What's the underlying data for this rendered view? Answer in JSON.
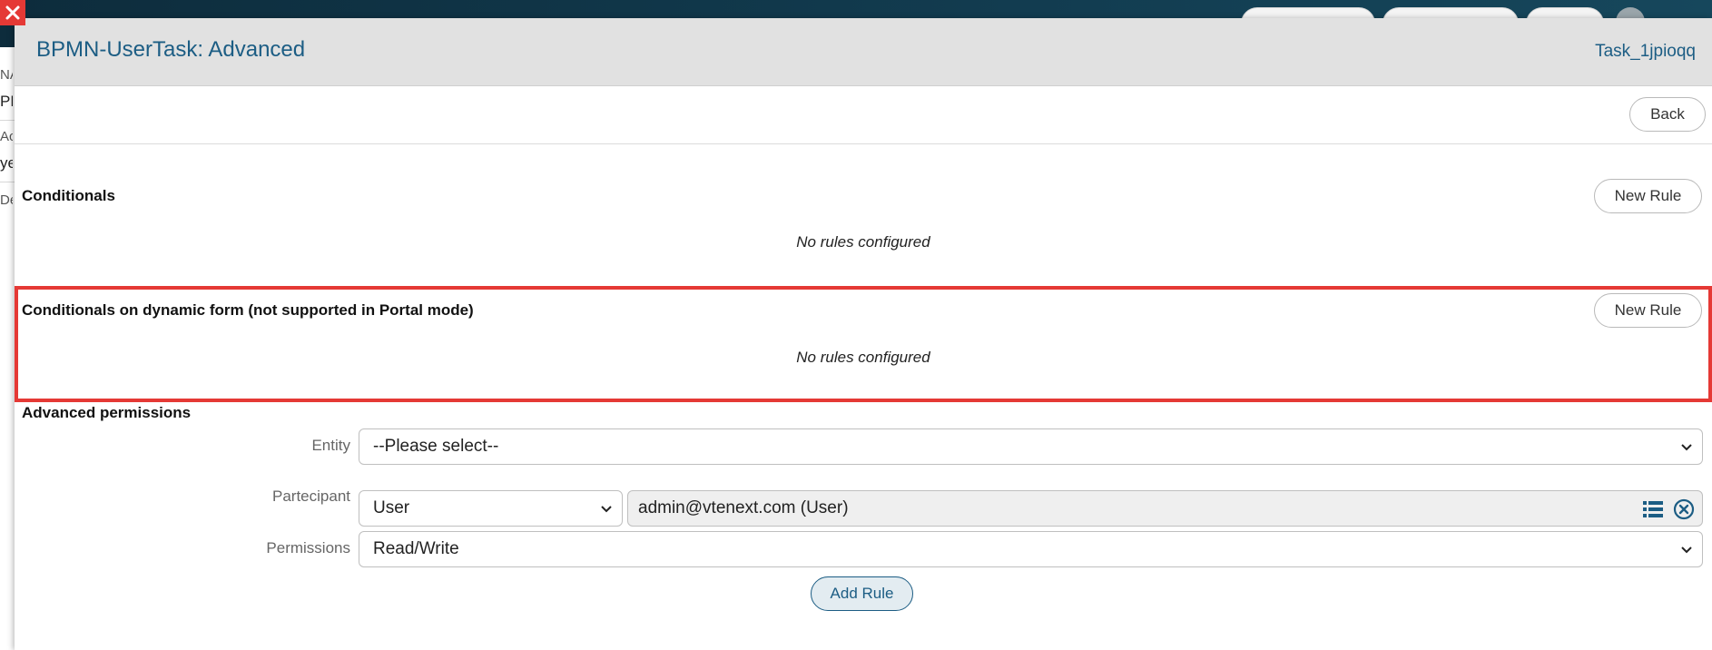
{
  "background": {
    "left_fragments": [
      "NA",
      "PH",
      "Ac",
      "ye",
      "De"
    ]
  },
  "modal": {
    "title": "BPMN-UserTask: Advanced",
    "task_id": "Task_1jpioqq",
    "back_label": "Back"
  },
  "conditionals": {
    "title": "Conditionals",
    "new_rule_label": "New Rule",
    "empty_text": "No rules configured"
  },
  "dynamic_conditionals": {
    "title": "Conditionals on dynamic form (not supported in Portal mode)",
    "new_rule_label": "New Rule",
    "empty_text": "No rules configured"
  },
  "advanced_permissions": {
    "title": "Advanced permissions",
    "entity_label": "Entity",
    "entity_value": "--Please select--",
    "participant_label": "Partecipant",
    "participant_type": "User",
    "participant_value": "admin@vtenext.com (User)",
    "permissions_label": "Permissions",
    "permissions_value": "Read/Write",
    "add_rule_label": "Add Rule"
  },
  "colors": {
    "accent": "#1c5d84",
    "highlight": "#e53935",
    "header_bg": "#e1e1e1"
  }
}
